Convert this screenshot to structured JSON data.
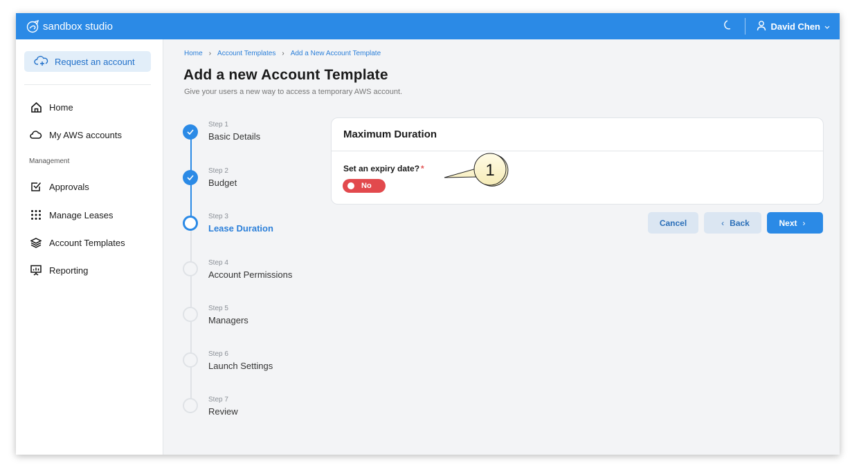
{
  "app": {
    "brand": "sandbox studio",
    "user_name": "David Chen"
  },
  "sidebar": {
    "request_label": "Request an account",
    "items": [
      {
        "label": "Home",
        "icon": "home-icon"
      },
      {
        "label": "My AWS accounts",
        "icon": "cloud-icon"
      }
    ],
    "section_label": "Management",
    "management_items": [
      {
        "label": "Approvals",
        "icon": "checkbox-icon"
      },
      {
        "label": "Manage Leases",
        "icon": "grid-dots-icon"
      },
      {
        "label": "Account Templates",
        "icon": "layers-icon"
      },
      {
        "label": "Reporting",
        "icon": "presentation-icon"
      }
    ]
  },
  "breadcrumb": [
    "Home",
    "Account Templates",
    "Add a New Account Template"
  ],
  "page": {
    "title": "Add a new Account Template",
    "subtitle": "Give your users a new way to access a temporary AWS account."
  },
  "steps": [
    {
      "num": "Step 1",
      "label": "Basic Details",
      "state": "done"
    },
    {
      "num": "Step 2",
      "label": "Budget",
      "state": "done"
    },
    {
      "num": "Step 3",
      "label": "Lease Duration",
      "state": "active"
    },
    {
      "num": "Step 4",
      "label": "Account Permissions",
      "state": "todo"
    },
    {
      "num": "Step 5",
      "label": "Managers",
      "state": "todo"
    },
    {
      "num": "Step 6",
      "label": "Launch Settings",
      "state": "todo"
    },
    {
      "num": "Step 7",
      "label": "Review",
      "state": "todo"
    }
  ],
  "card": {
    "title": "Maximum Duration",
    "field_label": "Set an expiry date?",
    "required_mark": "*",
    "toggle_value": "No"
  },
  "buttons": {
    "cancel": "Cancel",
    "back": "Back",
    "next": "Next"
  },
  "annotation": {
    "number": "1"
  },
  "colors": {
    "primary": "#2b8ae6",
    "toggle_off": "#e2494d",
    "secondary_btn": "#dbe6f2"
  }
}
